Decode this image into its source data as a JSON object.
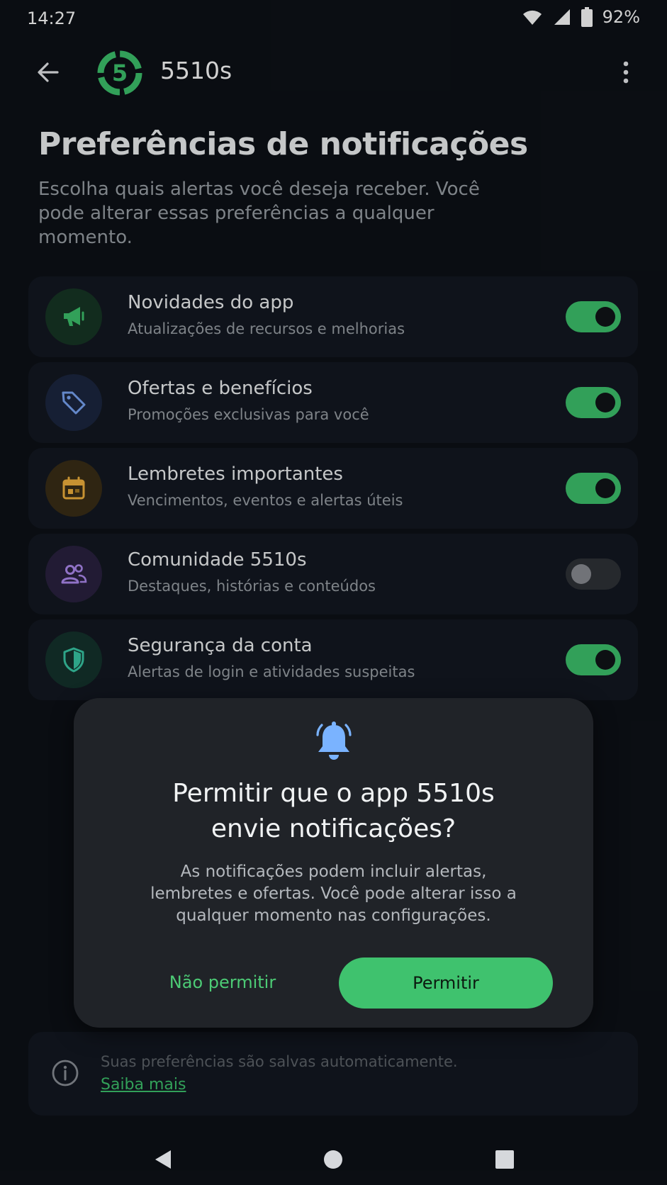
{
  "status_bar": {
    "time": "14:27",
    "battery_percent": "92%"
  },
  "app_bar": {
    "title": "5510s",
    "logo_text": "5"
  },
  "page": {
    "title": "Preferências de notificações",
    "subtitle": "Escolha quais alertas você deseja receber. Você pode alterar essas preferências a qualquer momento."
  },
  "preferences": [
    {
      "title": "Novidades do app",
      "description": "Atualizações de recursos e melhorias",
      "icon": "megaphone-icon",
      "enabled": true,
      "icon_color": "#3ec46d",
      "icon_bg": "#173625"
    },
    {
      "title": "Ofertas e benefícios",
      "description": "Promoções exclusivas para você",
      "icon": "tag-icon",
      "enabled": true,
      "icon_color": "#7aa7f7",
      "icon_bg": "#1c2740"
    },
    {
      "title": "Lembretes importantes",
      "description": "Vencimentos, eventos e alertas úteis",
      "icon": "calendar-icon",
      "enabled": true,
      "icon_color": "#f3b33d",
      "icon_bg": "#3a2e17"
    },
    {
      "title": "Comunidade 5510s",
      "description": "Destaques, histórias e conteúdos",
      "icon": "people-icon",
      "enabled": false,
      "icon_color": "#b08cf2",
      "icon_bg": "#2a2140"
    },
    {
      "title": "Segurança da conta",
      "description": "Alertas de login e atividades suspeitas",
      "icon": "shield-icon",
      "enabled": true,
      "icon_color": "#39c9a6",
      "icon_bg": "#14332d"
    }
  ],
  "dialog": {
    "title_line1": "Permitir que o app  5510s",
    "title_line2": "envie notificações?",
    "body": "As notificações podem incluir alertas, lembretes e ofertas. Você pode alterar isso a qualquer momento nas configurações.",
    "deny_label": "Não permitir",
    "allow_label": "Permitir",
    "icon": "bell-icon"
  },
  "info": {
    "text": "Suas preferências são salvas automaticamente.",
    "link": "Saiba mais"
  },
  "colors": {
    "accent": "#3ec46d",
    "background": "#0d1117",
    "card": "#131821",
    "dialog": "#202328"
  }
}
